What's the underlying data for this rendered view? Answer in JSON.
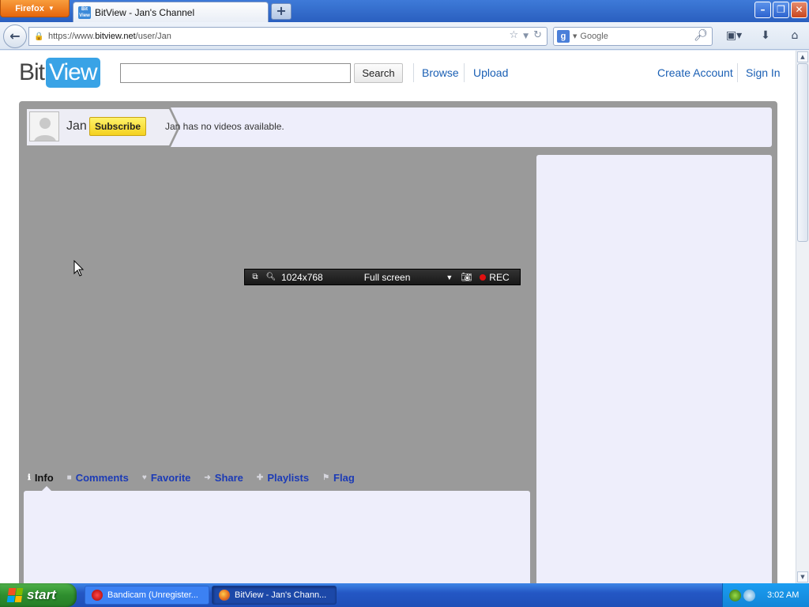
{
  "browser": {
    "menu_label": "Firefox",
    "tab_title": "BitView - Jan's Channel",
    "new_tab_label": "+",
    "url_prefix": "https://www.",
    "url_host": "bitview.net",
    "url_path": "/user/Jan",
    "search_engine_letter": "g",
    "search_placeholder": "Google"
  },
  "site": {
    "logo_bit": "Bit",
    "logo_view": "View",
    "search_value": "",
    "search_button": "Search",
    "nav": [
      "Browse",
      "Upload"
    ],
    "account": [
      "Create Account",
      "Sign In"
    ]
  },
  "channel": {
    "username": "Jan",
    "subscribe_label": "Subscribe",
    "no_videos_text": "Jan has no videos available."
  },
  "video_tabs": [
    {
      "label": "Info",
      "icon": "info-icon",
      "active": true
    },
    {
      "label": "Comments",
      "icon": "comment-icon",
      "active": false
    },
    {
      "label": "Favorite",
      "icon": "heart-icon",
      "active": false
    },
    {
      "label": "Share",
      "icon": "share-arrow-icon",
      "active": false
    },
    {
      "label": "Playlists",
      "icon": "plus-icon",
      "active": false
    },
    {
      "label": "Flag",
      "icon": "flag-icon",
      "active": false
    }
  ],
  "recorder": {
    "resolution": "1024x768",
    "mode": "Full screen",
    "rec_label": "REC"
  },
  "taskbar": {
    "start_label": "start",
    "tasks": [
      "Bandicam (Unregister...",
      "BitView - Jan's Chann..."
    ],
    "clock": "3:02 AM"
  },
  "colors": {
    "link": "#1a5fb4",
    "logo_accent": "#39a3e6",
    "subscribe": "#f4d11f",
    "channel_bg": "#9a9a9a",
    "panel_bg": "#eeeefb",
    "tab_link": "#1c3bb6"
  }
}
